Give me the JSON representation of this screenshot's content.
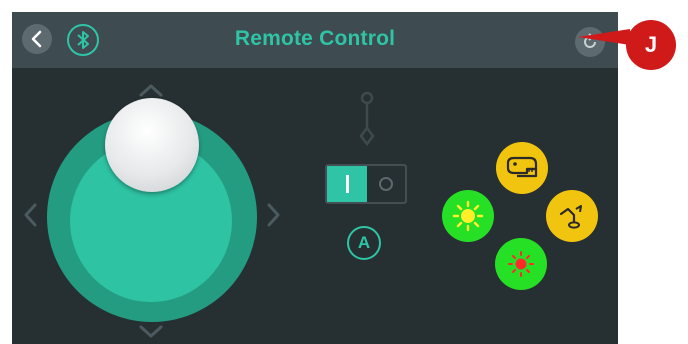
{
  "header": {
    "title": "Remote Control",
    "back_icon": "chevron-left-icon",
    "bluetooth_icon": "bluetooth-icon",
    "refresh_icon": "refresh-icon"
  },
  "joystick": {
    "direction_icons": [
      "chevron-up-icon",
      "chevron-down-icon",
      "chevron-left-icon",
      "chevron-right-icon"
    ]
  },
  "mode_toggle": {
    "selected": "I"
  },
  "auto_button": {
    "label": "A"
  },
  "actions": {
    "head_icon": "dinosaur-head-icon",
    "arm_icon": "arm-icon",
    "light_icon": "sun-light-icon",
    "red_light_icon": "red-light-icon"
  },
  "annotation": {
    "label": "J"
  },
  "colors": {
    "background": "#263033",
    "header": "#3e4b50",
    "accent": "#2ec4a5",
    "joystick_outer": "#249c82",
    "joystick_inner": "#2ec3a3",
    "action_yellow": "#f1c40f",
    "action_green": "#26e026",
    "marker_red": "#d01a1a"
  }
}
